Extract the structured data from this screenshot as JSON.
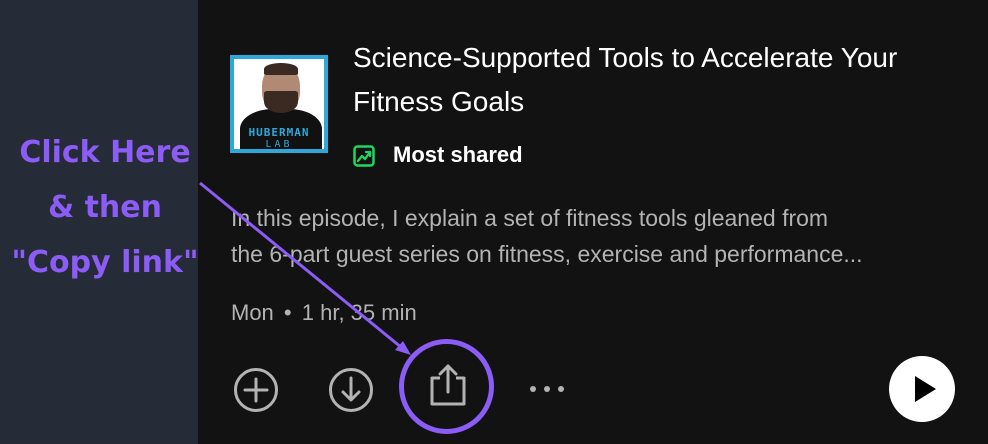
{
  "annotation": {
    "line1": "Click Here",
    "line2": "& then",
    "line3": "\"Copy link\"",
    "color": "#8b5cf6"
  },
  "episode": {
    "cover_brand_line1": "HUBERMAN",
    "cover_brand_line2": "LAB",
    "title": "Science-Supported Tools to Accelerate Your Fitness Goals",
    "badge_label": "Most shared",
    "badge_color": "#1ed760",
    "description_line1": "In this episode, I explain a set of fitness tools gleaned from",
    "description_line2": "the 6-part guest series on fitness, exercise and performance...",
    "date": "Mon",
    "separator": "•",
    "duration": "1 hr, 35 min"
  },
  "actions": {
    "add_icon": "plus-circle-icon",
    "download_icon": "download-circle-icon",
    "share_icon": "share-icon",
    "more_icon": "more-dots-icon",
    "play_icon": "play-icon"
  }
}
